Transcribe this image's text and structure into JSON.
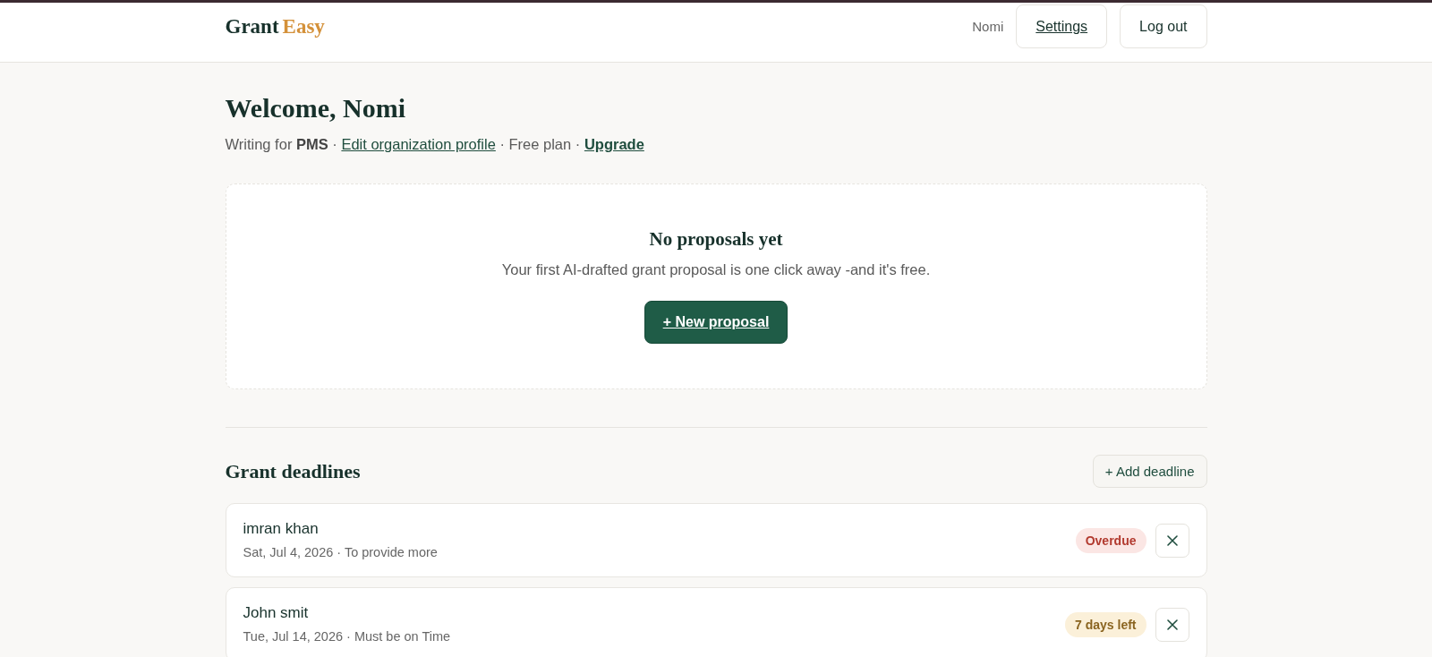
{
  "header": {
    "logo": {
      "primary": "Grant",
      "accent": "Easy"
    },
    "user_name": "Nomi",
    "buttons": [
      {
        "label": "Settings",
        "kind": "link"
      },
      {
        "label": "Log out",
        "kind": "plain"
      }
    ]
  },
  "welcome": {
    "title": "Welcome, Nomi",
    "summary": [
      {
        "kind": "text",
        "text": "Writing for **PMS** · "
      },
      {
        "kind": "link",
        "text": "Edit organization profile"
      },
      {
        "kind": "text",
        "text": " · Free plan · "
      },
      {
        "kind": "strong_link",
        "text": "Upgrade"
      }
    ]
  },
  "empty_state": {
    "title": "No proposals yet",
    "message": "Your first AI-drafted grant proposal is one click away -and it's free.",
    "button": "+ New proposal"
  },
  "deadlines": {
    "title": "Grant deadlines",
    "add_button": "+ Add deadline",
    "items": [
      {
        "name": "imran khan",
        "details": "Sat, Jul 4, 2026 · To provide more",
        "status": "Overdue",
        "kind": "overdue"
      },
      {
        "name": "John smit",
        "details": "Tue, Jul 14, 2026 · Must be on Time",
        "status": "7 days left",
        "kind": "upcoming"
      }
    ]
  }
}
